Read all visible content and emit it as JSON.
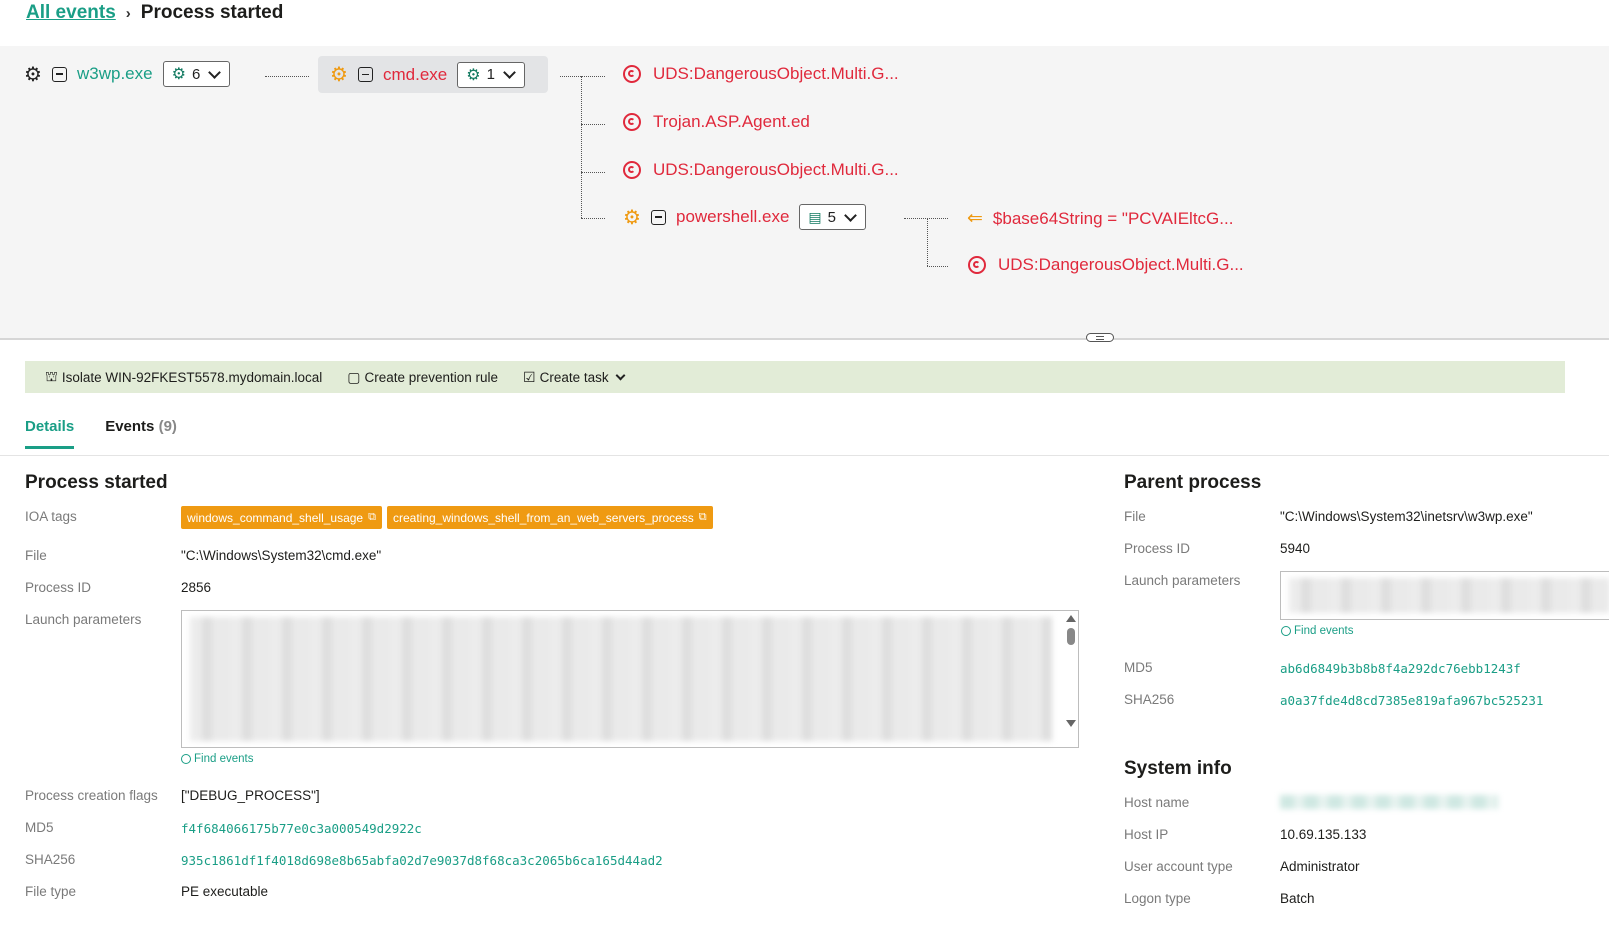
{
  "breadcrumb": {
    "back": "All events",
    "sep": "›",
    "current": "Process started"
  },
  "tree": {
    "root": {
      "name": "w3wp.exe",
      "count": "6"
    },
    "child": {
      "name": "cmd.exe",
      "count": "1"
    },
    "threats": [
      "UDS:DangerousObject.Multi.G...",
      "Trojan.ASP.Agent.ed",
      "UDS:DangerousObject.Multi.G..."
    ],
    "powershell": {
      "name": "powershell.exe",
      "count": "5"
    },
    "ps_children": [
      "$base64String = \"PCVAIEltcG...",
      "UDS:DangerousObject.Multi.G..."
    ]
  },
  "actions": {
    "isolate": "Isolate WIN-92FKEST5578.mydomain.local",
    "prevention": "Create prevention rule",
    "task": "Create task"
  },
  "tabs": {
    "details": "Details",
    "events": "Events",
    "events_count": "(9)"
  },
  "process": {
    "title": "Process started",
    "labels": {
      "ioa": "IOA tags",
      "file": "File",
      "pid": "Process ID",
      "launch": "Launch parameters",
      "flags": "Process creation flags",
      "md5": "MD5",
      "sha256": "SHA256",
      "filetype": "File type"
    },
    "tags": [
      "windows_command_shell_usage",
      "creating_windows_shell_from_an_web_servers_process"
    ],
    "file": "\"C:\\Windows\\System32\\cmd.exe\"",
    "pid": "2856",
    "find_events": "Find events",
    "flags": "[\"DEBUG_PROCESS\"]",
    "md5": "f4f684066175b77e0c3a000549d2922c",
    "sha256": "935c1861df1f4018d698e8b65abfa02d7e9037d8f68ca3c2065b6ca165d44ad2",
    "filetype": "PE executable"
  },
  "parent": {
    "title": "Parent process",
    "labels": {
      "file": "File",
      "pid": "Process ID",
      "launch": "Launch parameters",
      "md5": "MD5",
      "sha256": "SHA256"
    },
    "file": "\"C:\\Windows\\System32\\inetsrv\\w3wp.exe\"",
    "pid": "5940",
    "find_events": "Find events",
    "md5": "ab6d6849b3b8b8f4a292dc76ebb1243f",
    "sha256": "a0a37fde4d8cd7385e819afa967bc525231"
  },
  "system": {
    "title": "System info",
    "labels": {
      "host": "Host name",
      "ip": "Host IP",
      "account": "User account type",
      "logon": "Logon type"
    },
    "ip": "10.69.135.133",
    "account": "Administrator",
    "logon": "Batch"
  },
  "colors": {
    "accent": "#1a9e86",
    "threat": "#e0293c",
    "tag": "#ef9a12",
    "action_bar": "#e2ecd7"
  }
}
